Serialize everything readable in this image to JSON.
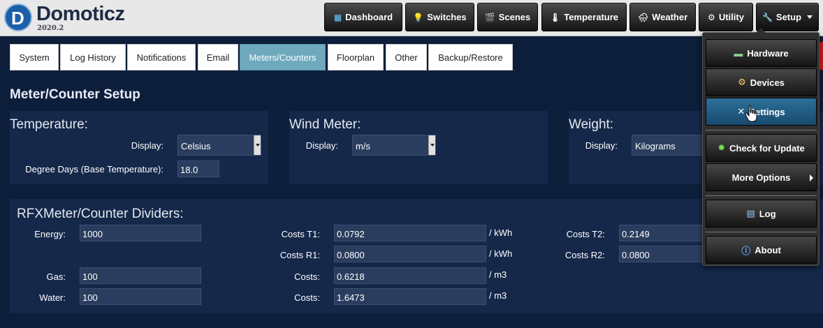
{
  "brand": {
    "name": "Domoticz",
    "version": "2020.2",
    "logo_letter": "D"
  },
  "nav": [
    {
      "label": "Dashboard",
      "icon": "dashboard-icon",
      "glyph": "▦"
    },
    {
      "label": "Switches",
      "icon": "bulb-icon",
      "glyph": "💡"
    },
    {
      "label": "Scenes",
      "icon": "clapper-icon",
      "glyph": "🎬"
    },
    {
      "label": "Temperature",
      "icon": "thermometer-icon",
      "glyph": "🌡"
    },
    {
      "label": "Weather",
      "icon": "cloud-icon",
      "glyph": "🌧"
    },
    {
      "label": "Utility",
      "icon": "utility-icon",
      "glyph": "⚙"
    },
    {
      "label": "Setup",
      "icon": "wrench-icon",
      "glyph": "🔧"
    }
  ],
  "tabs": [
    "System",
    "Log History",
    "Notifications",
    "Email",
    "Meters/Counters",
    "Floorplan",
    "Other",
    "Backup/Restore"
  ],
  "section_title": "Meter/Counter Setup",
  "temperature": {
    "title": "Temperature:",
    "display_label": "Display:",
    "display_value": "Celsius",
    "degree_label": "Degree Days (Base Temperature):",
    "degree_value": "18.0"
  },
  "wind": {
    "title": "Wind Meter:",
    "display_label": "Display:",
    "display_value": "m/s"
  },
  "weight": {
    "title": "Weight:",
    "display_label": "Display:",
    "display_value": "Kilograms"
  },
  "dividers": {
    "title": "RFXMeter/Counter Dividers:",
    "energy_label": "Energy:",
    "energy_value": "1000",
    "gas_label": "Gas:",
    "gas_value": "100",
    "water_label": "Water:",
    "water_value": "100",
    "costs_t1_label": "Costs T1:",
    "costs_t1_value": "0.0792",
    "costs_t1_unit": "/ kWh",
    "costs_r1_label": "Costs R1:",
    "costs_r1_value": "0.0800",
    "costs_r1_unit": "/ kWh",
    "costs_gas_label": "Costs:",
    "costs_gas_value": "0.6218",
    "costs_gas_unit": "/ m3",
    "costs_water_label": "Costs:",
    "costs_water_value": "1.6473",
    "costs_water_unit": "/ m3",
    "costs_t2_label": "Costs T2:",
    "costs_t2_value": "0.2149",
    "costs_r2_label": "Costs R2:",
    "costs_r2_value": "0.0800"
  },
  "menu": [
    {
      "label": "Hardware",
      "glyph": "▬"
    },
    {
      "label": "Devices",
      "glyph": "⚙"
    },
    {
      "label": "Settings",
      "glyph": "✕"
    },
    {
      "label": "Check for Update",
      "glyph": "✹"
    },
    {
      "label": "More Options",
      "glyph": ""
    },
    {
      "label": "Log",
      "glyph": "▤"
    },
    {
      "label": "About",
      "glyph": "ⓘ"
    }
  ],
  "colors": {
    "background": "#0d1e3b",
    "panel": "#15284a",
    "active_tab": "#6fa9bd",
    "selected_menu": "#2c6f9a"
  }
}
